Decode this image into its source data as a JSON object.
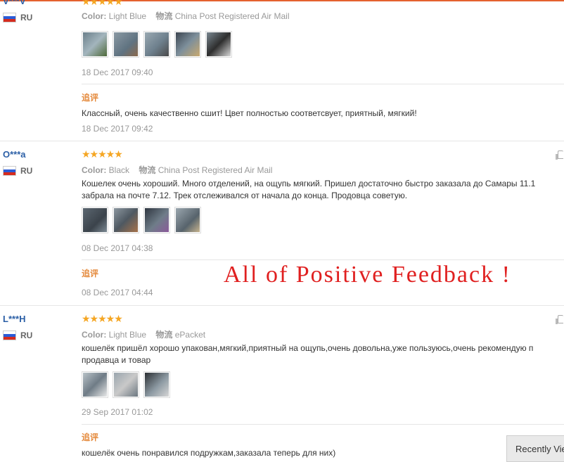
{
  "reviews": [
    {
      "user": "V***V",
      "country": "RU",
      "stars": "★★★★★",
      "color_label": "Color:",
      "color_value": "Light Blue",
      "logistics_label": "物流",
      "logistics_value": "China Post Registered Air Mail",
      "text": "",
      "photo_count": 5,
      "date": "18 Dec 2017 09:40",
      "followup_label": "追评",
      "followup_text": "Классный, очень качественно сшит! Цвет полностью соответсвует, приятный, мягкий!",
      "followup_date": "18 Dec 2017 09:42"
    },
    {
      "user": "O***a",
      "country": "RU",
      "stars": "★★★★★",
      "color_label": "Color:",
      "color_value": "Black",
      "logistics_label": "物流",
      "logistics_value": "China Post Registered Air Mail",
      "text_line1": "Кошелек очень хороший. Много отделений, на ощупь мягкий. Пришел достаточно быстро заказала до Самары 11.1",
      "text_line2": "забрала на почте 7.12. Трек отслеживался от начала до конца. Продовца советую.",
      "photo_count": 4,
      "date": "08 Dec 2017 04:38",
      "followup_label": "追评",
      "followup_text": "",
      "followup_date": "08 Dec 2017 04:44"
    },
    {
      "user": "L***H",
      "country": "RU",
      "stars": "★★★★★",
      "color_label": "Color:",
      "color_value": "Light Blue",
      "logistics_label": "物流",
      "logistics_value": "ePacket",
      "text_line1": "кошелёк пришёл хорошо упакован,мягкий,приятный на ощупь,очень довольна,уже пользуюсь,очень рекомендую п",
      "text_line2": "продавца и товар",
      "photo_count": 3,
      "date": "29 Sep 2017 01:02",
      "followup_label": "追评",
      "followup_text": "кошелёк очень понравился подружкам,заказала теперь для них)"
    }
  ],
  "banner": "All of Positive Feedback !",
  "recently_viewed": "Recently Vie",
  "colors": {
    "accent": "#e4612e",
    "star": "#f5a623",
    "username": "#2b5fa6",
    "banner": "#e02020"
  }
}
